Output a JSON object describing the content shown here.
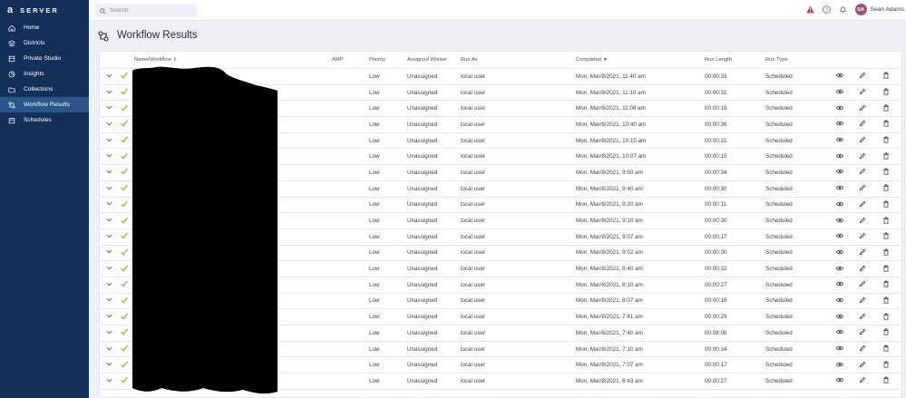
{
  "brand": {
    "logo": "a",
    "name": "SERVER"
  },
  "sidebar": {
    "items": [
      {
        "label": "Home",
        "icon": "home-icon"
      },
      {
        "label": "Districts",
        "icon": "districts-icon"
      },
      {
        "label": "Private Studio",
        "icon": "studio-icon"
      },
      {
        "label": "Insights",
        "icon": "insights-icon"
      },
      {
        "label": "Collections",
        "icon": "folder-icon"
      },
      {
        "label": "Workflow Results",
        "icon": "workflow-icon",
        "active": true
      },
      {
        "label": "Schedules",
        "icon": "calendar-icon"
      }
    ]
  },
  "topbar": {
    "search_placeholder": "Search",
    "user_initials": "SA",
    "user_name": "Sean Adams"
  },
  "page": {
    "title": "Workflow Results"
  },
  "table": {
    "headers": {
      "name": "Name/Workflow",
      "amp": "AMP",
      "priority": "Priority",
      "worker": "Assigned Worker",
      "run_as": "Run As",
      "completed": "Completed",
      "run_length": "Run Length",
      "run_type": "Run Type"
    },
    "rows": [
      {
        "priority": "Low",
        "worker": "Unassigned",
        "run_as": "local user",
        "completed": "Mon, Mar/8/2021, 11:40 am",
        "run_length": "00:00:33",
        "run_type": "Scheduled"
      },
      {
        "priority": "Low",
        "worker": "Unassigned",
        "run_as": "local user",
        "completed": "Mon, Mar/8/2021, 11:10 am",
        "run_length": "00:00:31",
        "run_type": "Scheduled"
      },
      {
        "priority": "Low",
        "worker": "Unassigned",
        "run_as": "local user",
        "completed": "Mon, Mar/8/2021, 11:08 am",
        "run_length": "00:00:16",
        "run_type": "Scheduled"
      },
      {
        "priority": "Low",
        "worker": "Unassigned",
        "run_as": "local user",
        "completed": "Mon, Mar/8/2021, 10:40 am",
        "run_length": "00:00:36",
        "run_type": "Scheduled"
      },
      {
        "priority": "Low",
        "worker": "Unassigned",
        "run_as": "local user",
        "completed": "Mon, Mar/8/2021, 10:10 am",
        "run_length": "00:00:31",
        "run_type": "Scheduled"
      },
      {
        "priority": "Low",
        "worker": "Unassigned",
        "run_as": "local user",
        "completed": "Mon, Mar/8/2021, 10:07 am",
        "run_length": "00:00:15",
        "run_type": "Scheduled"
      },
      {
        "priority": "Low",
        "worker": "Unassigned",
        "run_as": "local user",
        "completed": "Mon, Mar/8/2021, 9:50 am",
        "run_length": "00:00:34",
        "run_type": "Scheduled"
      },
      {
        "priority": "Low",
        "worker": "Unassigned",
        "run_as": "local user",
        "completed": "Mon, Mar/8/2021, 9:40 am",
        "run_length": "00:00:30",
        "run_type": "Scheduled"
      },
      {
        "priority": "Low",
        "worker": "Unassigned",
        "run_as": "local user",
        "completed": "Mon, Mar/8/2021, 9:20 am",
        "run_length": "00:00:11",
        "run_type": "Scheduled"
      },
      {
        "priority": "Low",
        "worker": "Unassigned",
        "run_as": "local user",
        "completed": "Mon, Mar/8/2021, 9:10 am",
        "run_length": "00:00:30",
        "run_type": "Scheduled"
      },
      {
        "priority": "Low",
        "worker": "Unassigned",
        "run_as": "local user",
        "completed": "Mon, Mar/8/2021, 9:07 am",
        "run_length": "00:00:17",
        "run_type": "Scheduled"
      },
      {
        "priority": "Low",
        "worker": "Unassigned",
        "run_as": "local user",
        "completed": "Mon, Mar/8/2021, 9:02 am",
        "run_length": "00:00:30",
        "run_type": "Scheduled"
      },
      {
        "priority": "Low",
        "worker": "Unassigned",
        "run_as": "local user",
        "completed": "Mon, Mar/8/2021, 8:40 am",
        "run_length": "00:00:32",
        "run_type": "Scheduled"
      },
      {
        "priority": "Low",
        "worker": "Unassigned",
        "run_as": "local user",
        "completed": "Mon, Mar/8/2021, 8:10 am",
        "run_length": "00:00:27",
        "run_type": "Scheduled"
      },
      {
        "priority": "Low",
        "worker": "Unassigned",
        "run_as": "local user",
        "completed": "Mon, Mar/8/2021, 8:07 am",
        "run_length": "00:00:16",
        "run_type": "Scheduled"
      },
      {
        "priority": "Low",
        "worker": "Unassigned",
        "run_as": "local user",
        "completed": "Mon, Mar/8/2021, 7:41 am",
        "run_length": "00:00:29",
        "run_type": "Scheduled"
      },
      {
        "priority": "Low",
        "worker": "Unassigned",
        "run_as": "local user",
        "completed": "Mon, Mar/8/2021, 7:40 am",
        "run_length": "00:08:08",
        "run_type": "Scheduled"
      },
      {
        "priority": "Low",
        "worker": "Unassigned",
        "run_as": "local user",
        "completed": "Mon, Mar/8/2021, 7:10 am",
        "run_length": "00:00:34",
        "run_type": "Scheduled"
      },
      {
        "priority": "Low",
        "worker": "Unassigned",
        "run_as": "local user",
        "completed": "Mon, Mar/8/2021, 7:07 am",
        "run_length": "00:00:17",
        "run_type": "Scheduled"
      },
      {
        "priority": "Low",
        "worker": "Unassigned",
        "run_as": "local user",
        "completed": "Mon, Mar/8/2021, 6:43 am",
        "run_length": "00:00:27",
        "run_type": "Scheduled"
      }
    ]
  },
  "colors": {
    "sidebar_bg": "#12305a",
    "sidebar_active": "#2b5689",
    "success_check": "#7cc42c",
    "alert": "#d6335c",
    "avatar": "#a0507a"
  }
}
